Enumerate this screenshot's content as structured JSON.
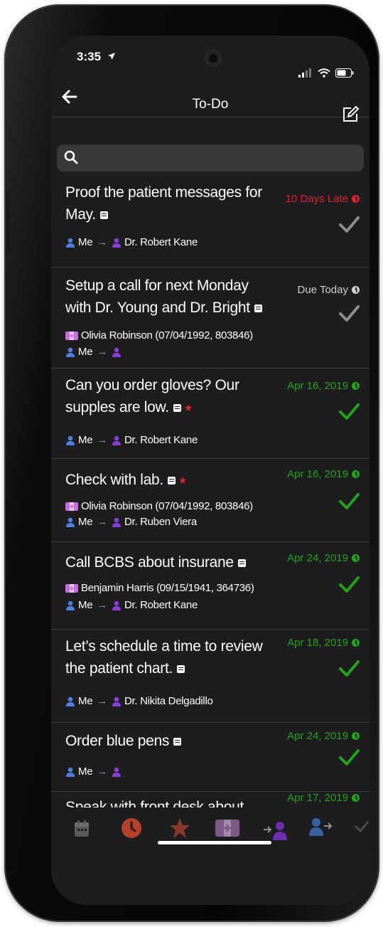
{
  "status": {
    "time": "3:35"
  },
  "nav": {
    "title": "To-Do"
  },
  "search": {
    "placeholder": ""
  },
  "colors": {
    "late": "#e0212e",
    "today": "#cfcfcf",
    "done": "#23a21c",
    "me": "#4f7fe0",
    "provider": "#8b3ed6",
    "patient": "#c46fd8"
  },
  "todos": [
    {
      "title": "Proof the patient messages for May.",
      "due": "10 Days Late",
      "status": "late",
      "starred": false,
      "patient": "",
      "from": "Me",
      "to": "Dr. Robert Kane"
    },
    {
      "title": "Setup  a call for next Monday with Dr. Young and Dr. Bright",
      "due": "Due Today",
      "status": "today",
      "starred": false,
      "patient": "Olivia Robinson (07/04/1992, 803846)",
      "from": "Me",
      "to": ""
    },
    {
      "title": "Can you order gloves? Our supples are  low.",
      "due": "Apr 16, 2019",
      "status": "done",
      "starred": true,
      "patient": "",
      "from": "Me",
      "to": "Dr. Robert Kane"
    },
    {
      "title": "Check with lab.",
      "due": "Apr 16, 2019",
      "status": "done",
      "starred": true,
      "patient": "Olivia Robinson (07/04/1992, 803846)",
      "from": "Me",
      "to": "Dr. Ruben Viera"
    },
    {
      "title": "Call BCBS about insurane",
      "due": "Apr 24, 2019",
      "status": "done",
      "starred": false,
      "patient": "Benjamin Harris (09/15/1941, 364736)",
      "from": "Me",
      "to": "Dr. Robert Kane"
    },
    {
      "title": "Let’s schedule a time to review the patient chart.",
      "due": "Apr 18, 2019",
      "status": "done",
      "starred": false,
      "patient": "",
      "from": "Me",
      "to": "Dr. Nikita Delgadillo"
    },
    {
      "title": "Order blue pens",
      "due": "Apr 24, 2019",
      "status": "done",
      "starred": false,
      "patient": "",
      "from": "Me",
      "to": ""
    },
    {
      "title": "Speak with front desk about new",
      "due": "Apr 17, 2019",
      "status": "done",
      "starred": false,
      "patient": "",
      "from": "",
      "to": ""
    }
  ],
  "tabs": [
    {
      "icon": "calendar-icon",
      "active": false
    },
    {
      "icon": "clock-icon",
      "active": true
    },
    {
      "icon": "star-icon",
      "active": false
    },
    {
      "icon": "patient-card-icon",
      "active": false
    },
    {
      "icon": "assigned-to-me-icon",
      "active": false
    },
    {
      "icon": "assigned-by-me-icon",
      "active": false
    },
    {
      "icon": "completed-icon",
      "active": false
    }
  ]
}
